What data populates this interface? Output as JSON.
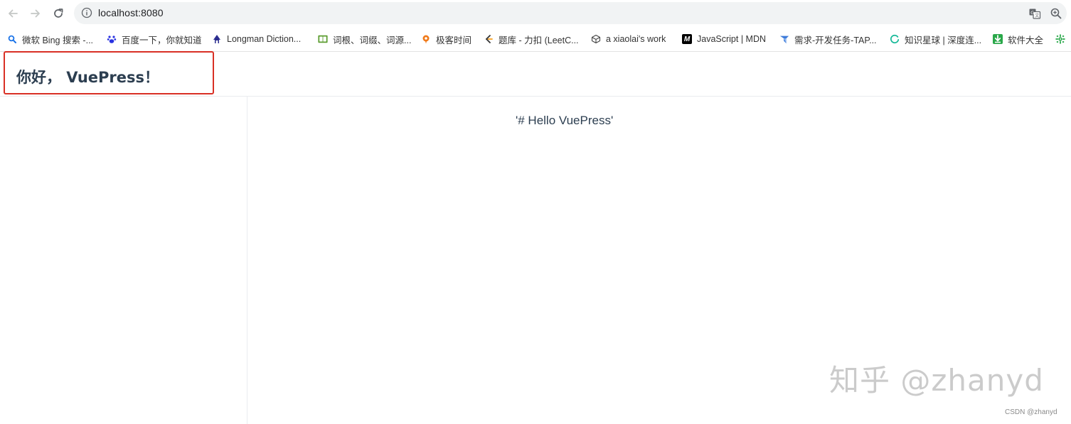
{
  "browser": {
    "url": "localhost:8080",
    "icons": {
      "back": "back-arrow-icon",
      "forward": "forward-arrow-icon",
      "reload": "reload-icon",
      "info": "info-icon",
      "translate": "translate-icon",
      "zoom": "zoom-icon"
    }
  },
  "bookmarks": [
    {
      "label": "微软 Bing 搜索 -...",
      "icon": "bing-search-icon",
      "color": "#1a73e8"
    },
    {
      "label": "百度一下，你就知道",
      "icon": "baidu-paw-icon",
      "color": "#2932e1"
    },
    {
      "label": "Longman Diction...",
      "icon": "longman-icon",
      "color": "#2b2d8f"
    },
    {
      "label": "词根、词缀、词源...",
      "icon": "etymology-book-icon",
      "color": "#5b9c2f"
    },
    {
      "label": "极客时间",
      "icon": "geektime-icon",
      "color": "#f07a1a"
    },
    {
      "label": "题库 - 力扣 (LeetC...",
      "icon": "leetcode-icon",
      "color": "#f89f1b"
    },
    {
      "label": "a xiaolai's work",
      "icon": "cube-icon",
      "color": "#444444"
    },
    {
      "label": "JavaScript | MDN",
      "icon": "mdn-icon",
      "color": "#000000"
    },
    {
      "label": "需求-开发任务-TAP...",
      "icon": "tapd-icon",
      "color": "#3d7bd9"
    },
    {
      "label": "知识星球 | 深度连...",
      "icon": "zsxq-ring-icon",
      "color": "#16b998"
    },
    {
      "label": "软件大全",
      "icon": "download-icon",
      "color": "#2aa84a"
    },
    {
      "label": "",
      "icon": "gear-flower-icon",
      "color": "#2aa84a"
    }
  ],
  "page": {
    "site_title": "你好， VuePress！",
    "content_text": "'# Hello VuePress'",
    "highlight_color": "#d93025"
  },
  "watermark": "知乎 @zhanyd",
  "credit": "CSDN @zhanyd"
}
